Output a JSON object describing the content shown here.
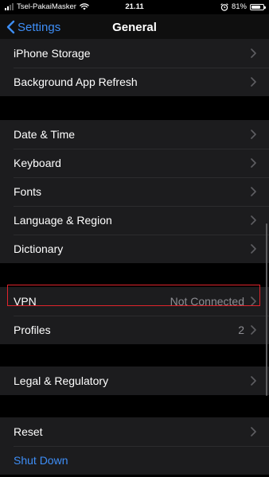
{
  "status_bar": {
    "carrier": "Tsel-PakaiMasker",
    "time": "21.11",
    "battery_percent": "81%",
    "battery_level": 0.81,
    "icons": [
      "signal-icon",
      "wifi-icon",
      "alarm-icon",
      "battery-icon"
    ]
  },
  "nav": {
    "back_label": "Settings",
    "title": "General"
  },
  "groups": [
    {
      "rows": [
        {
          "label": "iPhone Storage"
        },
        {
          "label": "Background App Refresh"
        }
      ]
    },
    {
      "rows": [
        {
          "label": "Date & Time"
        },
        {
          "label": "Keyboard"
        },
        {
          "label": "Fonts"
        },
        {
          "label": "Language & Region"
        },
        {
          "label": "Dictionary"
        }
      ]
    },
    {
      "rows": [
        {
          "label": "VPN",
          "value": "Not Connected"
        },
        {
          "label": "Profiles",
          "value": "2"
        }
      ]
    },
    {
      "rows": [
        {
          "label": "Legal & Regulatory"
        }
      ]
    },
    {
      "rows": [
        {
          "label": "Reset"
        },
        {
          "label": "Shut Down"
        }
      ]
    }
  ],
  "colors": {
    "accent": "#3e8ef7",
    "highlight": "#e0242c",
    "row_background": "#1c1c1e",
    "background": "#000000"
  }
}
